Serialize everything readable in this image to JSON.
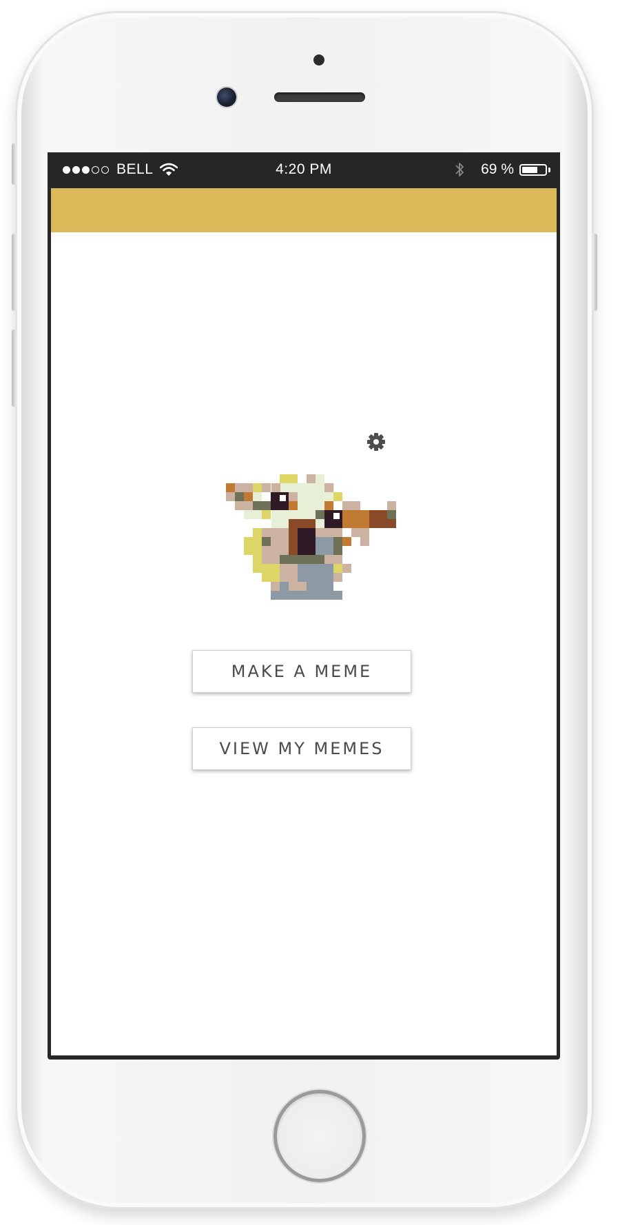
{
  "status_bar": {
    "signal": {
      "filled": 3,
      "total": 5
    },
    "carrier": "BELL",
    "time": "4:20 PM",
    "battery_percent": "69 %",
    "battery_level": 0.69,
    "icons": [
      "signal-dots-icon",
      "wifi-icon",
      "bluetooth-icon",
      "battery-icon"
    ]
  },
  "app": {
    "header_color": "#dbb858",
    "settings_icon": "gear-icon",
    "logo_icon": "pixel-bird-logo",
    "buttons": {
      "make_meme": "MAKE A MEME",
      "view_memes": "VIEW MY MEMES"
    }
  },
  "device": {
    "home_button_icon": "home-button"
  }
}
